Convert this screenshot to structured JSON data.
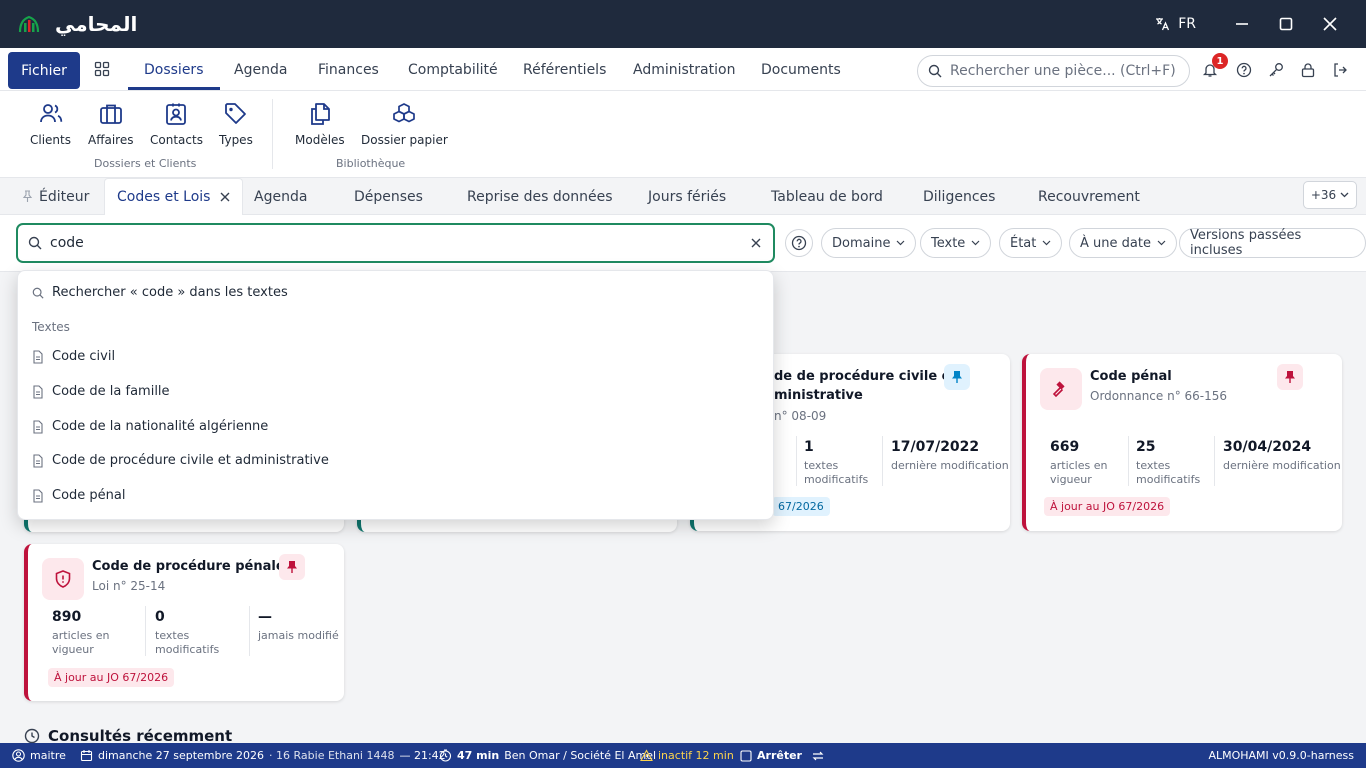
{
  "app": {
    "name": "المحامي",
    "language": "FR"
  },
  "menu": {
    "fichier": "Fichier",
    "tabs": [
      "Dossiers",
      "Agenda",
      "Finances",
      "Comptabilité",
      "Référentiels",
      "Administration",
      "Documents"
    ],
    "search_placeholder": "Rechercher une pièce... (Ctrl+F)",
    "notification_count": "1"
  },
  "ribbon": {
    "group1": {
      "label": "Dossiers et Clients",
      "items": [
        "Clients",
        "Affaires",
        "Contacts",
        "Types"
      ]
    },
    "group2": {
      "label": "Bibliothèque",
      "items": [
        "Modèles",
        "Dossier papier"
      ]
    }
  },
  "doc_tabs": {
    "items": [
      "Éditeur",
      "Codes et Lois",
      "Agenda",
      "Dépenses",
      "Reprise des données",
      "Jours fériés",
      "Tableau de bord",
      "Diligences",
      "Recouvrement"
    ],
    "more": "+36"
  },
  "filters": {
    "search_value": "code",
    "chips": [
      "Domaine",
      "Texte",
      "État",
      "À une date",
      "Versions passées incluses"
    ]
  },
  "dropdown": {
    "search_all": "Rechercher « code » dans les textes",
    "section": "Textes",
    "items": [
      "Code civil",
      "Code de la famille",
      "Code de la nationalité algérienne",
      "Code de procédure civile et administrative",
      "Code pénal"
    ]
  },
  "cards": {
    "cpca": {
      "title_line1": "de de procédure civile et",
      "title_line2": "ministrative",
      "sub": "n° 08-09",
      "stat1_num": "1",
      "stat1_lab1": "textes",
      "stat1_lab2": "modificatifs",
      "stat2_num": "17/07/2022",
      "stat2_lab": "dernière modification",
      "jo": "67/2026"
    },
    "penal": {
      "title": "Code pénal",
      "sub": "Ordonnance n° 66-156",
      "stat1_num": "669",
      "stat1_lab1": "articles en",
      "stat1_lab2": "vigueur",
      "stat2_num": "25",
      "stat2_lab1": "textes",
      "stat2_lab2": "modificatifs",
      "stat3_num": "30/04/2024",
      "stat3_lab": "dernière modification",
      "jo": "À jour au JO 67/2026"
    },
    "cpp": {
      "title": "Code de procédure pénale",
      "sub": "Loi n° 25-14",
      "stat1_num": "890",
      "stat1_lab1": "articles en",
      "stat1_lab2": "vigueur",
      "stat2_num": "0",
      "stat2_lab1": "textes",
      "stat2_lab2": "modificatifs",
      "stat3_num": "—",
      "stat3_lab": "jamais modifié",
      "jo": "À jour au JO 67/2026"
    }
  },
  "recent": {
    "title": "Consultés récemment"
  },
  "status": {
    "user": "maitre",
    "date": "dimanche 27 septembre 2026",
    "hijri": "· 16 Rabie Ethani 1448",
    "time": "— 21:42",
    "timer": "47 min",
    "client": "Ben Omar / Société El Amel",
    "inactive": "inactif 12 min",
    "stop": "Arrêter",
    "version": "ALMOHAMI v0.9.0-harness"
  },
  "colors": {
    "titlebar": "#1f2a3d",
    "accent": "#1e3a8a",
    "danger": "#be123c",
    "search_focus": "#1f8a60",
    "info": "#0284c7"
  }
}
